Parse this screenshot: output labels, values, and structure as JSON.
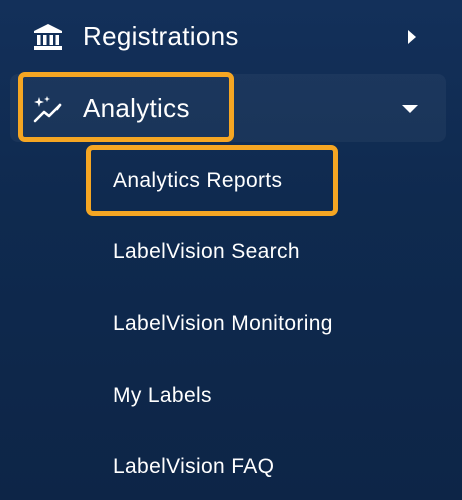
{
  "sidebar": {
    "items": [
      {
        "label": "Registrations",
        "icon": "bank-icon",
        "expanded": false,
        "indicator": "caret-right-icon"
      },
      {
        "label": "Analytics",
        "icon": "sparkle-trend-icon",
        "expanded": true,
        "indicator": "caret-down-icon",
        "highlighted": true,
        "children": [
          {
            "label": "Analytics Reports",
            "highlighted": true
          },
          {
            "label": "LabelVision Search"
          },
          {
            "label": "LabelVision Monitoring"
          },
          {
            "label": "My Labels"
          },
          {
            "label": "LabelVision FAQ"
          }
        ]
      }
    ]
  },
  "colors": {
    "background_top": "#13305a",
    "background_bottom": "#0d2547",
    "highlight": "#f5a623",
    "text": "#ffffff"
  }
}
